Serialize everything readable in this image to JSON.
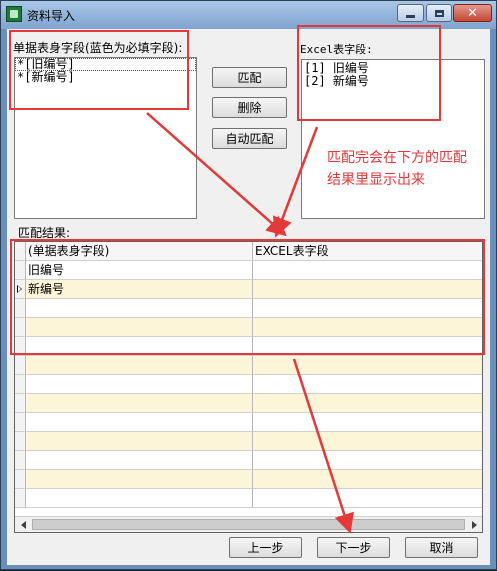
{
  "window": {
    "title": "资料导入",
    "icon": "app-table-icon"
  },
  "left_list": {
    "label": "单据表身字段(蓝色为必填字段):",
    "items": [
      "*[旧编号]",
      "*[新编号]"
    ]
  },
  "right_list": {
    "label": "Excel表字段:",
    "items": [
      "[1] 旧编号",
      "[2] 新编号"
    ]
  },
  "actions": {
    "match": "匹配",
    "delete": "删除",
    "auto_match": "自动匹配"
  },
  "annotation": {
    "lines": [
      "匹配完会在下方的匹配",
      "结果里显示出来"
    ],
    "color": "#e23a3a"
  },
  "result": {
    "label": "匹配结果:",
    "columns": [
      "(单据表身字段)",
      "EXCEL表字段"
    ],
    "rows": [
      [
        "旧编号",
        ""
      ],
      [
        "新编号",
        ""
      ],
      [
        "",
        ""
      ],
      [
        "",
        ""
      ],
      [
        "",
        ""
      ],
      [
        "",
        ""
      ],
      [
        "",
        ""
      ],
      [
        "",
        ""
      ],
      [
        "",
        ""
      ],
      [
        "",
        ""
      ],
      [
        "",
        ""
      ],
      [
        "",
        ""
      ],
      [
        "",
        ""
      ]
    ],
    "current_row": 1,
    "row_colors": {
      "odd": "#ffffff",
      "even": "#fdf5d7"
    }
  },
  "footer": {
    "prev": "上一步",
    "next": "下一步",
    "cancel": "取消"
  }
}
